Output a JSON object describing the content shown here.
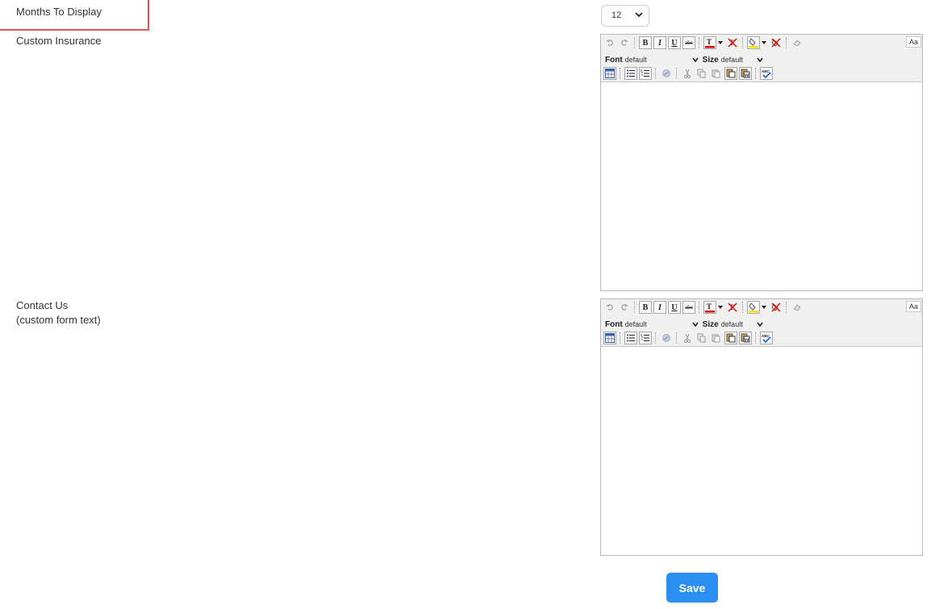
{
  "form": {
    "months_label": "Months To Display",
    "months_value": "12",
    "custom_insurance_label": "Custom Insurance",
    "contact_us_label": "Contact Us",
    "contact_us_sublabel": "(custom form text)",
    "save_label": "Save"
  },
  "editor_toolbar": {
    "bold": "B",
    "italic": "I",
    "underline": "U",
    "strike": "abc",
    "font_label": "Font",
    "font_value": "default",
    "size_label": "Size",
    "size_value": "default",
    "case_toggle": "Aa"
  },
  "colors": {
    "accent": "#2b8ff2",
    "highlight_border": "#e05656",
    "text_color_bar": "#e00000",
    "bg_color_bar": "#f2e200"
  }
}
